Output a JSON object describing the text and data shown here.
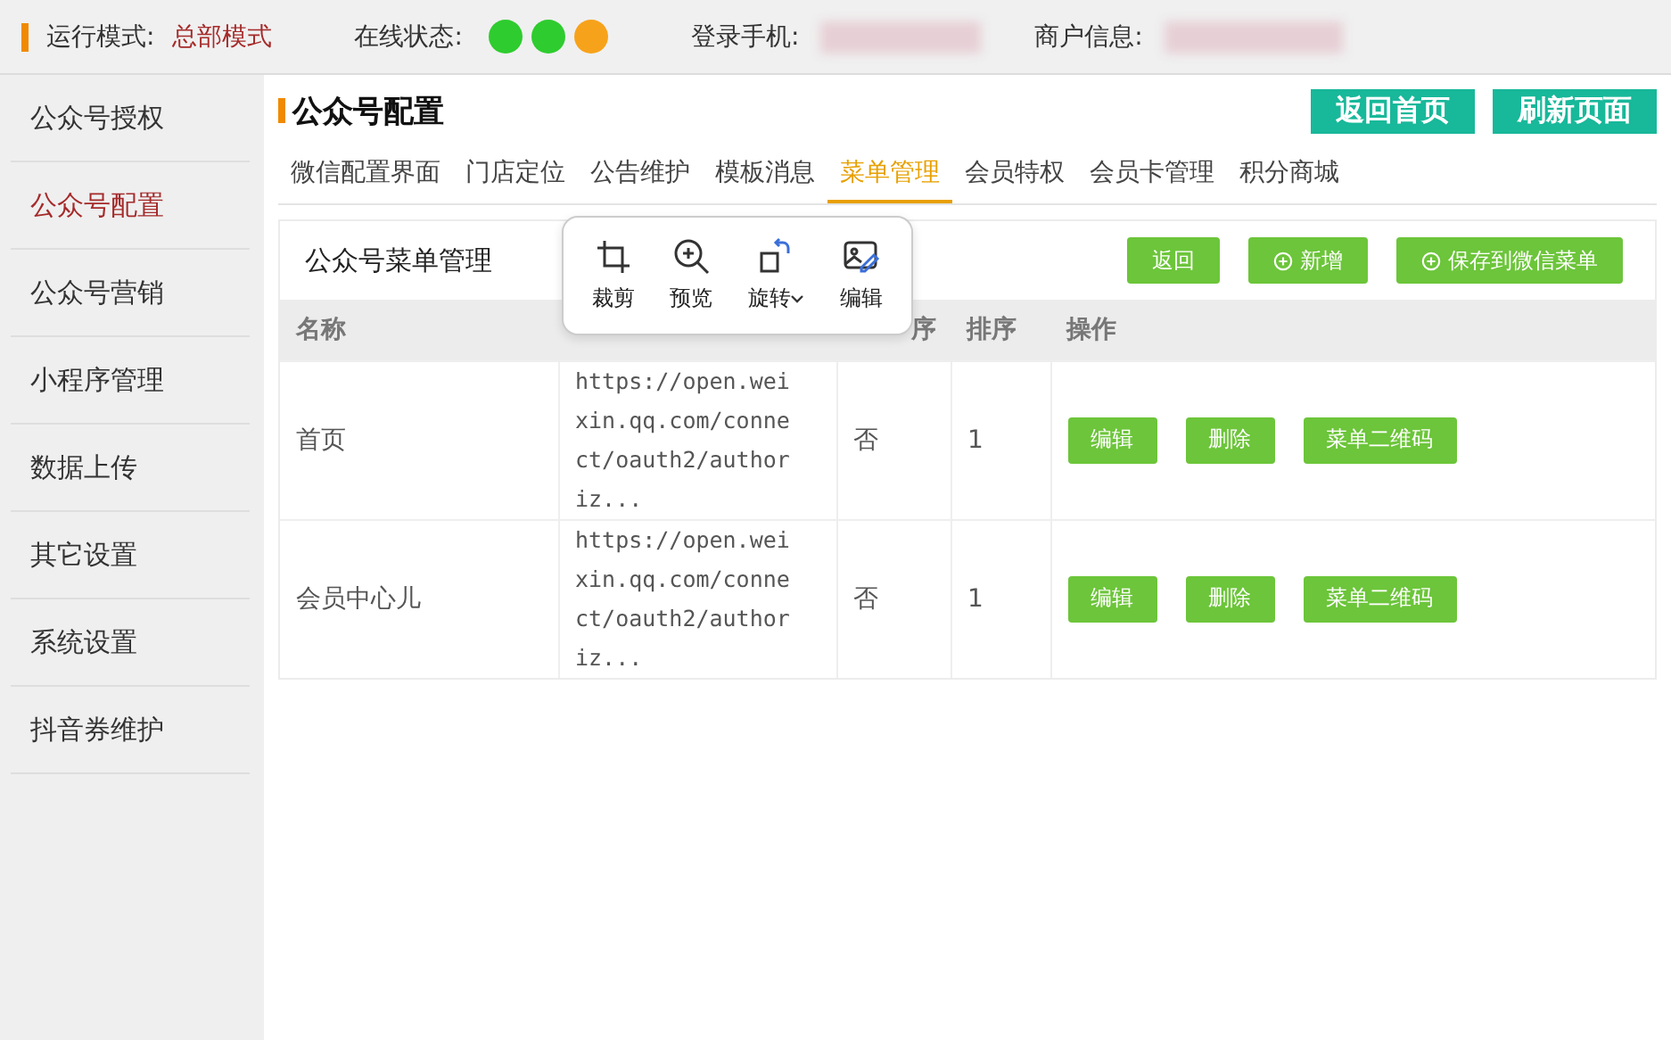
{
  "top_bar": {
    "mode_label": "运行模式:",
    "mode_value": "总部模式",
    "status_label": "在线状态:",
    "status_dots": [
      {
        "color": "#2ecc2e"
      },
      {
        "color": "#2ecc2e"
      },
      {
        "color": "#f7a21b"
      }
    ],
    "phone_label": "登录手机:",
    "merchant_label": "商户信息:"
  },
  "sidebar": {
    "items": [
      {
        "label": "公众号授权",
        "selected": false
      },
      {
        "label": "公众号配置",
        "selected": true
      },
      {
        "label": "公众号营销",
        "selected": false
      },
      {
        "label": "小程序管理",
        "selected": false
      },
      {
        "label": "数据上传",
        "selected": false
      },
      {
        "label": "其它设置",
        "selected": false
      },
      {
        "label": "系统设置",
        "selected": false
      },
      {
        "label": "抖音券维护",
        "selected": false
      }
    ]
  },
  "page": {
    "title": "公众号配置",
    "buttons": [
      "返回首页",
      "刷新页面"
    ],
    "tabs": [
      {
        "label": "微信配置界面",
        "selected": false
      },
      {
        "label": "门店定位",
        "selected": false
      },
      {
        "label": "公告维护",
        "selected": false
      },
      {
        "label": "模板消息",
        "selected": false
      },
      {
        "label": "菜单管理",
        "selected": true
      },
      {
        "label": "会员特权",
        "selected": false
      },
      {
        "label": "会员卡管理",
        "selected": false
      },
      {
        "label": "积分商城",
        "selected": false
      }
    ]
  },
  "panel": {
    "title": "公众号菜单管理",
    "buttons": [
      {
        "label": "返回",
        "kind": "plain"
      },
      {
        "label": "新增",
        "kind": "add"
      },
      {
        "label": "保存到微信菜单",
        "kind": "add"
      }
    ]
  },
  "image_toolbar": {
    "items": [
      {
        "label": "裁剪",
        "kind": "crop"
      },
      {
        "label": "预览",
        "kind": "zoom"
      },
      {
        "label": "旋转",
        "kind": "rotate"
      },
      {
        "label": "编辑",
        "kind": "edit"
      }
    ]
  },
  "table": {
    "columns": [
      "名称",
      "",
      "序",
      "排序",
      "操作"
    ],
    "rows": [
      {
        "cells": [
          "首页",
          "https://open.weixin.qq.com/connect/oauth2/authoriz...",
          "否",
          "1"
        ],
        "actions": [
          "编辑",
          "删除",
          "菜单二维码"
        ]
      },
      {
        "cells": [
          "会员中心儿",
          "https://open.weixin.qq.com/connect/oauth2/authoriz...",
          "否",
          "1"
        ],
        "actions": [
          "编辑",
          "删除",
          "菜单二维码"
        ]
      }
    ]
  }
}
